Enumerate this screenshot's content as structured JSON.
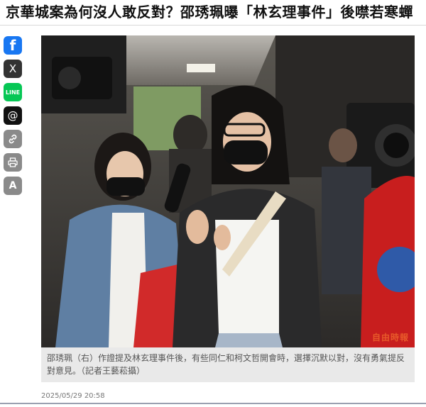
{
  "article": {
    "headline": "京華城案為何沒人敢反對？邵琇珮曝「林玄理事件」後噤若寒蟬",
    "caption": "邵琇珮（右）作證提及林玄理事件後，有些同仁和柯文哲開會時，選擇沉默以對，沒有勇氣提反對意見。（記者王藝菘攝）",
    "datetime": "2025/05/29 20:58",
    "watermark": "自由時報"
  },
  "share_bar": {
    "facebook_label": "f",
    "x_label": "X",
    "line_label": "LINE",
    "threads_label": "@",
    "font_label": "A"
  },
  "colors": {
    "facebook": "#1877f2",
    "x": "#333333",
    "line": "#06c755",
    "threads": "#111111",
    "link": "#8a8a8a",
    "print": "#8a8a8a",
    "font": "#8a8a8a"
  },
  "icons": [
    "facebook-icon",
    "x-icon",
    "line-icon",
    "threads-icon",
    "link-icon",
    "print-icon",
    "font-size-icon"
  ]
}
